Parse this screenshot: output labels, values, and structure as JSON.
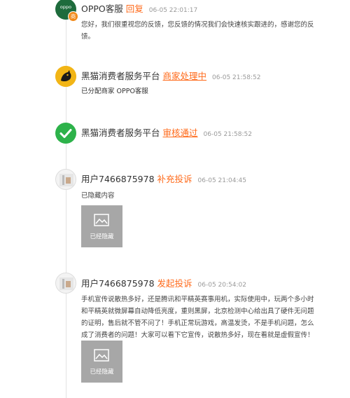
{
  "timeline": [
    {
      "sender": "OPPO客服",
      "action": "回复",
      "time": "06-05 22:01:17",
      "body": "您好，我们很重视您的反馈，您反馈的情况我们会快速核实跟进的，感谢您的反馈。",
      "avatar_text": "oppo",
      "avatar_badge": "商"
    },
    {
      "sender": "黑猫消费者服务平台",
      "action": "商家处理中",
      "time": "06-05 21:58:52",
      "body": "已分配商家 OPPO客服"
    },
    {
      "sender": "黑猫消费者服务平台",
      "action": "审核通过",
      "time": "06-05 21:58:52"
    },
    {
      "sender": "用户7466875978",
      "action": "补充投诉",
      "time": "06-05 21:04:45",
      "body": "已隐藏内容",
      "image_label": "已经隐藏"
    },
    {
      "sender": "用户7466875978",
      "action": "发起投诉",
      "time": "06-05 20:54:02",
      "body": "手机宣传说散热多好，还是腾讯和平精英赛事用机，实际使用中，玩两个多小时和平精英就微屏幕自动降低亮度，重则黑屏，北京检测中心给出具了硬件无问题的证明，售后就不管不问了！手机正常玩游戏，高温发烫，不是手机问题，怎么成了消费者的问题！大家可以看下它宣传，说散热多好，现在看就是虚假宣传！",
      "image_label": "已经隐藏"
    }
  ],
  "colors": {
    "accent": "#ff6a1a",
    "oppo_green": "#1e6b3c",
    "check_green": "#2db24a",
    "cat_gold": "#f2b516"
  }
}
